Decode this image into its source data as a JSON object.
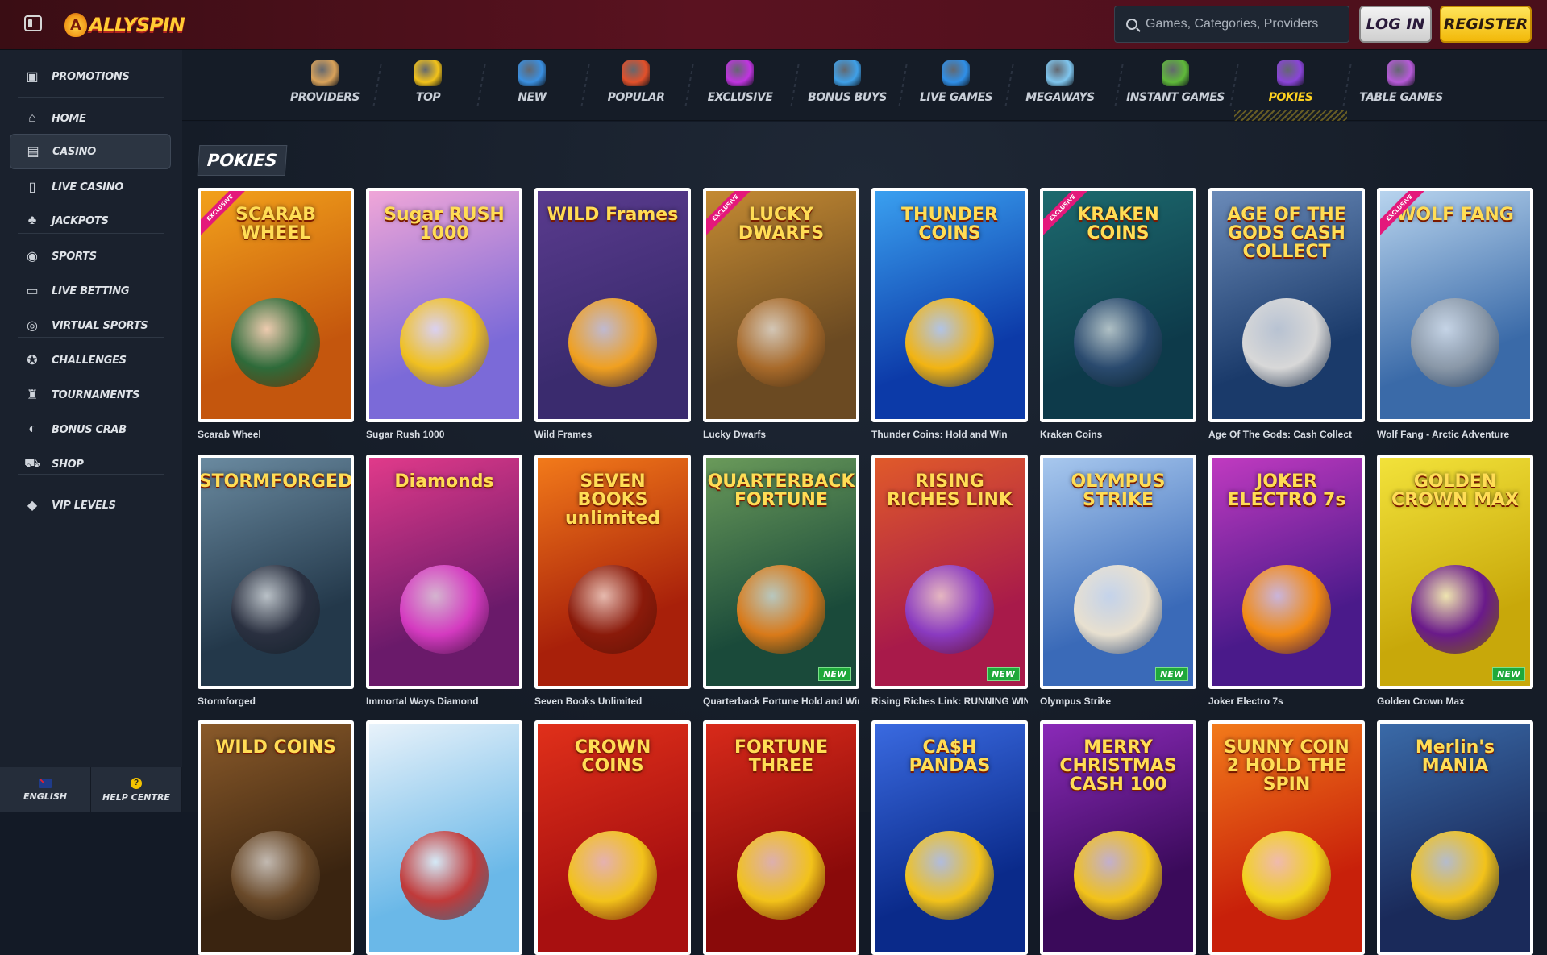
{
  "header": {
    "logo_text": "ALLYSPIN",
    "search_placeholder": "Games, Categories, Providers",
    "login_label": "LOG IN",
    "register_label": "REGISTER"
  },
  "sidebar": {
    "items": [
      {
        "label": "PROMOTIONS",
        "icon": "gift-icon"
      },
      {
        "label": "HOME",
        "icon": "home-icon"
      },
      {
        "label": "CASINO",
        "icon": "slot-machine-icon",
        "active": true
      },
      {
        "label": "LIVE CASINO",
        "icon": "cards-icon"
      },
      {
        "label": "JACKPOTS",
        "icon": "clover-icon"
      },
      {
        "label": "SPORTS",
        "icon": "ball-icon"
      },
      {
        "label": "LIVE BETTING",
        "icon": "live-icon"
      },
      {
        "label": "VIRTUAL SPORTS",
        "icon": "virtual-icon"
      },
      {
        "label": "CHALLENGES",
        "icon": "medal-icon"
      },
      {
        "label": "TOURNAMENTS",
        "icon": "trophy-icon"
      },
      {
        "label": "BONUS CRAB",
        "icon": "crab-icon"
      },
      {
        "label": "SHOP",
        "icon": "cart-icon"
      },
      {
        "label": "VIP LEVELS",
        "icon": "diamond-icon"
      }
    ],
    "bottom": {
      "language": "ENGLISH",
      "help": "HELP CENTRE"
    }
  },
  "categories": [
    {
      "label": "PROVIDERS",
      "color": "#d9a25a"
    },
    {
      "label": "TOP",
      "color": "#f2c21a"
    },
    {
      "label": "NEW",
      "color": "#3a8fe0"
    },
    {
      "label": "POPULAR",
      "color": "#e2502a"
    },
    {
      "label": "EXCLUSIVE",
      "color": "#c034e0"
    },
    {
      "label": "BONUS BUYS",
      "color": "#3fa0e8"
    },
    {
      "label": "LIVE GAMES",
      "color": "#2f8fe8"
    },
    {
      "label": "MEGAWAYS",
      "color": "#7fc6ef"
    },
    {
      "label": "INSTANT GAMES",
      "color": "#5fb83a"
    },
    {
      "label": "POKIES",
      "color": "#8a44d8",
      "active": true
    },
    {
      "label": "TABLE GAMES",
      "color": "#b65ad8"
    }
  ],
  "section_title": "POKIES",
  "games": [
    {
      "name": "Scarab Wheel",
      "title": "SCARAB WHEEL",
      "bg": "#c4560d",
      "bg2": "#f2a11b",
      "emblem": "#2e6b3a",
      "exclusive": true
    },
    {
      "name": "Sugar Rush 1000",
      "title": "Sugar RUSH 1000",
      "bg": "#7b6ad8",
      "bg2": "#f0a6d8",
      "emblem": "#f0c020"
    },
    {
      "name": "Wild Frames",
      "title": "WILD Frames",
      "bg": "#3a2b6e",
      "bg2": "#5a3b8e",
      "emblem": "#f0a020"
    },
    {
      "name": "Lucky Dwarfs",
      "title": "LUCKY DWARFS",
      "bg": "#6b4a22",
      "bg2": "#c48a32",
      "emblem": "#a86a2a",
      "exclusive": true
    },
    {
      "name": "Thunder Coins: Hold and Win",
      "title": "THUNDER COINS",
      "bg": "#0c3aa8",
      "bg2": "#3aa0f0",
      "emblem": "#f2b412"
    },
    {
      "name": "Kraken Coins",
      "title": "KRAKEN COINS",
      "bg": "#0d3a4a",
      "bg2": "#1d6a6e",
      "emblem": "#2a4a6e",
      "exclusive": true
    },
    {
      "name": "Age Of The Gods: Cash Collect",
      "title": "AGE OF THE GODS CASH COLLECT",
      "bg": "#1a3a6a",
      "bg2": "#6a8ab8",
      "emblem": "#d8d8d8"
    },
    {
      "name": "Wolf Fang - Arctic Adventure",
      "title": "WOLF FANG",
      "bg": "#3a6aa8",
      "bg2": "#b8d4ee",
      "emblem": "#8a98a8",
      "exclusive": true
    },
    {
      "name": "Stormforged",
      "title": "STORMFORGED",
      "bg": "#23384a",
      "bg2": "#6a8aa0",
      "emblem": "#2a3040"
    },
    {
      "name": "Immortal Ways Diamond",
      "title": "Diamonds",
      "bg": "#6a1a6a",
      "bg2": "#e03a8a",
      "emblem": "#d43ac0"
    },
    {
      "name": "Seven Books Unlimited",
      "title": "SEVEN BOOKS unlimited",
      "bg": "#a8200a",
      "bg2": "#f27a1a",
      "emblem": "#8a1a0a"
    },
    {
      "name": "Quarterback Fortune Hold and Win",
      "title": "QUARTERBACK FORTUNE",
      "bg": "#1a4a3a",
      "bg2": "#6a9a5a",
      "emblem": "#d87a1a",
      "new": true
    },
    {
      "name": "Rising Riches Link: RUNNING WINS",
      "title": "RISING RICHES LINK",
      "bg": "#a81a4a",
      "bg2": "#e05a2a",
      "emblem": "#8a3ac0",
      "new": true
    },
    {
      "name": "Olympus Strike",
      "title": "OLYMPUS STRIKE",
      "bg": "#3a6ab8",
      "bg2": "#a8c8ee",
      "emblem": "#e8e0d0",
      "new": true
    },
    {
      "name": "Joker Electro 7s",
      "title": "JOKER ELECTRO 7s",
      "bg": "#4a1a8a",
      "bg2": "#c03ac0",
      "emblem": "#f28a12"
    },
    {
      "name": "Golden Crown Max",
      "title": "GOLDEN CROWN MAX",
      "bg": "#c8a80a",
      "bg2": "#f2e23a",
      "emblem": "#6a1a8a",
      "new": true
    },
    {
      "name": "",
      "title": "WILD COINS",
      "bg": "#3a2410",
      "bg2": "#8a5a2a",
      "emblem": "#6a4a2a"
    },
    {
      "name": "",
      "title": "",
      "bg": "#6ab8e8",
      "bg2": "#e8f2fa",
      "emblem": "#c03a3a"
    },
    {
      "name": "",
      "title": "CROWN COINS",
      "bg": "#a81010",
      "bg2": "#e0301a",
      "emblem": "#f2c21a"
    },
    {
      "name": "",
      "title": "FORTUNE THREE",
      "bg": "#8a0a0a",
      "bg2": "#d82a1a",
      "emblem": "#f2c21a"
    },
    {
      "name": "",
      "title": "CA$H PANDAS",
      "bg": "#0a2a8a",
      "bg2": "#3a6ae0",
      "emblem": "#f2c21a"
    },
    {
      "name": "",
      "title": "MERRY CHRISTMAS CASH 100",
      "bg": "#3a0a5a",
      "bg2": "#8a2ab8",
      "emblem": "#f2c21a"
    },
    {
      "name": "",
      "title": "SUNNY COIN 2 HOLD THE SPIN",
      "bg": "#c8200a",
      "bg2": "#f27a1a",
      "emblem": "#f2d21a"
    },
    {
      "name": "",
      "title": "Merlin's MANIA",
      "bg": "#1a2a5a",
      "bg2": "#3a6aa8",
      "emblem": "#f2c21a"
    }
  ]
}
